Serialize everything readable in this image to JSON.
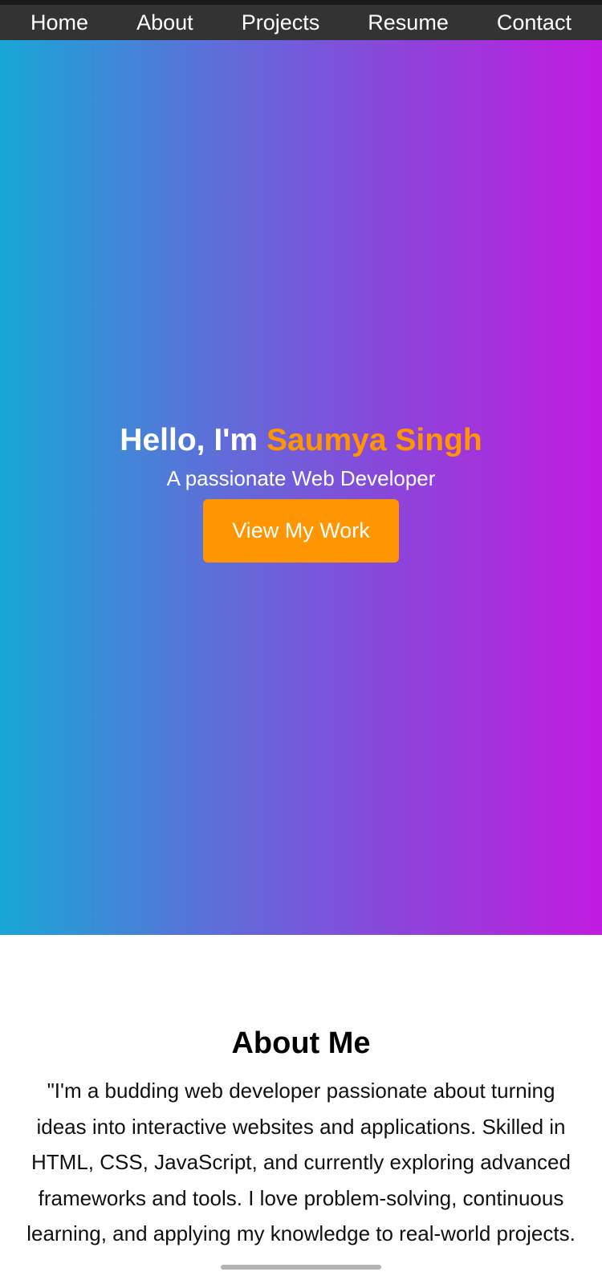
{
  "nav": {
    "items": [
      {
        "label": "Home"
      },
      {
        "label": "About"
      },
      {
        "label": "Projects"
      },
      {
        "label": "Resume"
      },
      {
        "label": "Contact"
      }
    ]
  },
  "hero": {
    "greeting": "Hello, I'm ",
    "name": "Saumya Singh",
    "subtitle": "A passionate Web Developer",
    "button_label": "View My Work"
  },
  "about": {
    "heading": "About Me",
    "text": "\"I'm a budding web developer passionate about turning ideas into interactive websites and applications. Skilled in HTML, CSS, JavaScript, and currently exploring advanced frameworks and tools. I love problem-solving, continuous learning, and applying my knowledge to real-world projects."
  },
  "colors": {
    "navbar": "#333333",
    "accent": "#ff9500",
    "gradient_start": "#19a7d6",
    "gradient_end": "#c21be0"
  }
}
